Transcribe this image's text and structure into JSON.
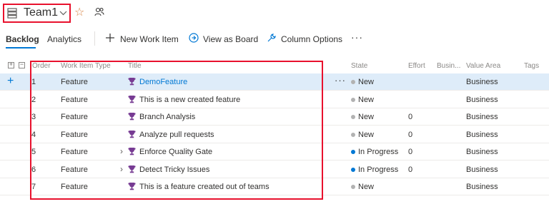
{
  "header": {
    "team_name": "Team1"
  },
  "tabs": {
    "backlog": "Backlog",
    "analytics": "Analytics"
  },
  "toolbar": {
    "new_work_item": "New Work Item",
    "view_as_board": "View as Board",
    "column_options": "Column Options",
    "more": "···"
  },
  "columns": {
    "order": "Order",
    "type": "Work Item Type",
    "title": "Title",
    "state": "State",
    "effort": "Effort",
    "business": "Busin...",
    "value_area": "Value Area",
    "tags": "Tags"
  },
  "rows": [
    {
      "order": "1",
      "type": "Feature",
      "title": "DemoFeature",
      "state": "New",
      "effort": "",
      "value_area": "Business",
      "expandable": false
    },
    {
      "order": "2",
      "type": "Feature",
      "title": "This is a new created feature",
      "state": "New",
      "effort": "",
      "value_area": "Business",
      "expandable": false
    },
    {
      "order": "3",
      "type": "Feature",
      "title": "Branch Analysis",
      "state": "New",
      "effort": "0",
      "value_area": "Business",
      "expandable": false
    },
    {
      "order": "4",
      "type": "Feature",
      "title": "Analyze pull requests",
      "state": "New",
      "effort": "0",
      "value_area": "Business",
      "expandable": false
    },
    {
      "order": "5",
      "type": "Feature",
      "title": "Enforce Quality Gate",
      "state": "In Progress",
      "effort": "0",
      "value_area": "Business",
      "expandable": true
    },
    {
      "order": "6",
      "type": "Feature",
      "title": "Detect Tricky Issues",
      "state": "In Progress",
      "effort": "0",
      "value_area": "Business",
      "expandable": true
    },
    {
      "order": "7",
      "type": "Feature",
      "title": "This is a feature created out of teams",
      "state": "New",
      "effort": "",
      "value_area": "Business",
      "expandable": false
    }
  ],
  "colors": {
    "accent": "#0078d4",
    "state_new": "#b2b2b2",
    "state_in_progress": "#0078d4",
    "feature_icon": "#773b93",
    "highlight": "#e8112d"
  }
}
